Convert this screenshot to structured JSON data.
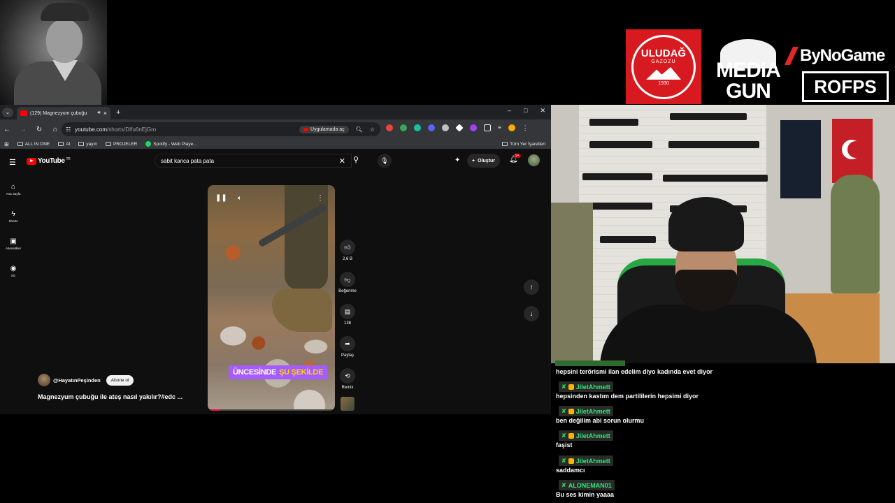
{
  "browser": {
    "tab": {
      "title": "(129) Magnezyum çubuğu"
    },
    "window_controls": {
      "minimize": "–",
      "maximize": "□",
      "close": "✕"
    },
    "omnibox": {
      "host": "youtube.com",
      "path": "/shorts/DIfu6nEjGro",
      "open_in_app": "Uygulamada aç"
    },
    "bookmarks": [
      {
        "label": "ALL IN ONE",
        "icon": "folder-icon"
      },
      {
        "label": "AI",
        "icon": "folder-icon"
      },
      {
        "label": "yayın",
        "icon": "folder-icon"
      },
      {
        "label": "PROJELER",
        "icon": "folder-icon"
      },
      {
        "label": "Spotify - Web Playe...",
        "icon": "spotify-icon"
      }
    ],
    "all_bookmarks": "Tüm Yer İşaretleri"
  },
  "youtube": {
    "logo": "YouTube",
    "region": "TR",
    "search": {
      "value": "sabit kanca pata pata"
    },
    "create_label": "Oluştur",
    "notifications_badge": "9+",
    "sidebar": [
      {
        "label": "Ana Sayfa",
        "icon": "home-icon",
        "glyph": "⌂"
      },
      {
        "label": "Shorts",
        "icon": "shorts-icon",
        "glyph": "ϟ"
      },
      {
        "label": "Abonelikler",
        "icon": "subscriptions-icon",
        "glyph": "▣"
      },
      {
        "label": "Siz",
        "icon": "you-icon",
        "glyph": "◉"
      }
    ],
    "short": {
      "caption_text": "ÜNCESİNDE",
      "caption_highlight": "ŞU ŞEKİLDE",
      "progress": 0.1,
      "channel": "@HayatınPeşinden",
      "subscribe": "Abone ol",
      "title": "Magnezyum çubuğu ile ateş nasıl yakılır?#edc ..."
    },
    "actions": {
      "likes": "2,6 B",
      "dislike": "Beğenme",
      "comments": "138",
      "share": "Paylaş",
      "remix": "Remix"
    }
  },
  "chat": {
    "messages": [
      {
        "user": null,
        "text": "hepsini terörismi ilan edelim diyo kadında evet diyor"
      },
      {
        "user": "JiletAhmett",
        "text": "hepsinden kastım dem partililerin hepsimi diyor"
      },
      {
        "user": "JiletAhmett",
        "text": "ben değilim abi sorun olurmu"
      },
      {
        "user": "JiletAhmett",
        "text": "faşist"
      },
      {
        "user": "JiletAhmett",
        "text": "saddamcı"
      },
      {
        "user": "ALONEMAN01",
        "text": "Bu ses kimin yaaaa"
      }
    ]
  },
  "sponsors": {
    "uludag": {
      "name": "ULUDAĞ",
      "sub": "GAZOZU",
      "year": "1930"
    },
    "media_gun": {
      "line1": "MEDIA",
      "line2": "GUN"
    },
    "bynogame": "ByNoGame",
    "rofps": "ROFPS"
  },
  "colors": {
    "youtube_red": "#ff0000",
    "mod_green": "#2ee672",
    "uludag_red": "#d71a20",
    "caption_purple": "#a65bff"
  }
}
